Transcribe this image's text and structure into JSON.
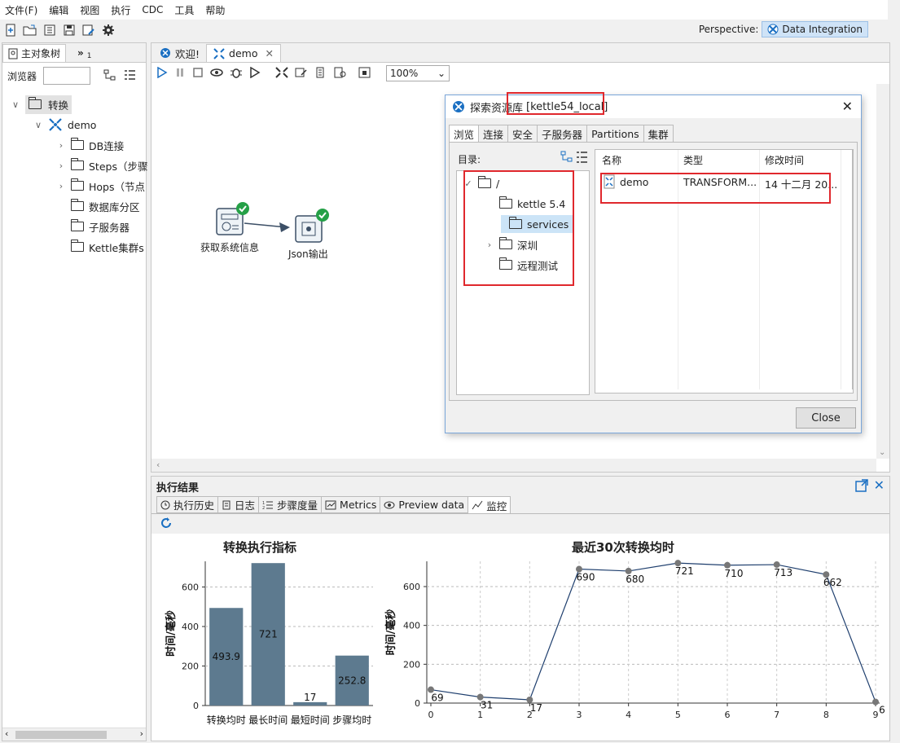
{
  "menu": [
    "文件(F)",
    "编辑",
    "视图",
    "执行",
    "CDC",
    "工具",
    "帮助"
  ],
  "perspective": {
    "label": "Perspective:",
    "value": "Data Integration"
  },
  "left_panel": {
    "tabs": [
      "主对象树",
      "»",
      "1"
    ],
    "browser_label": "浏览器",
    "tree": {
      "root": "转换",
      "transform": "demo",
      "children": [
        "DB连接",
        "Steps（步骤",
        "Hops（节点",
        "数据库分区",
        "子服务器",
        "Kettle集群s"
      ]
    }
  },
  "editor": {
    "tabs": [
      "欢迎!",
      "demo"
    ],
    "zoom": "100%",
    "steps": [
      "获取系统信息",
      "Json输出"
    ]
  },
  "dialog": {
    "title": "探索资源库",
    "repo": "[kettle54_local]",
    "tabs": [
      "浏览",
      "连接",
      "安全",
      "子服务器",
      "Partitions",
      "集群"
    ],
    "dir_label": "目录:",
    "dirs": [
      "/",
      "kettle 5.4",
      "services",
      "深圳",
      "远程测试"
    ],
    "columns": [
      "名称",
      "类型",
      "修改时间"
    ],
    "row": {
      "name": "demo",
      "type": "TRANSFORM...",
      "modified": "14 十二月 20..."
    },
    "close": "Close"
  },
  "results": {
    "title": "执行结果",
    "tabs": [
      "执行历史",
      "日志",
      "步骤度量",
      "Metrics",
      "Preview data",
      "监控"
    ]
  },
  "chart_data": [
    {
      "type": "bar",
      "title": "转换执行指标",
      "ylabel": "时间/毫秒",
      "categories": [
        "转换均时",
        "最长时间",
        "最短时间",
        "步骤均时"
      ],
      "values": [
        493.9,
        721,
        17,
        252.8
      ],
      "value_labels": [
        "493.9",
        "721",
        "17",
        "252.8"
      ],
      "yticks": [
        0,
        200,
        400,
        600
      ],
      "ylim": [
        0,
        730
      ],
      "color": "#5d7a8f"
    },
    {
      "type": "line",
      "title": "最近30次转换均时",
      "ylabel": "时间/毫秒",
      "x": [
        0,
        1,
        2,
        3,
        4,
        5,
        6,
        7,
        8,
        9
      ],
      "values": [
        69,
        31,
        17,
        690,
        680,
        721,
        710,
        713,
        662,
        6
      ],
      "point_labels": [
        "69",
        "31",
        "17",
        "690",
        "680",
        "721",
        "710",
        "713",
        "662",
        "6"
      ],
      "yticks": [
        0,
        200,
        400,
        600
      ],
      "ylim": [
        0,
        730
      ],
      "color": "#1f3f6e"
    }
  ]
}
